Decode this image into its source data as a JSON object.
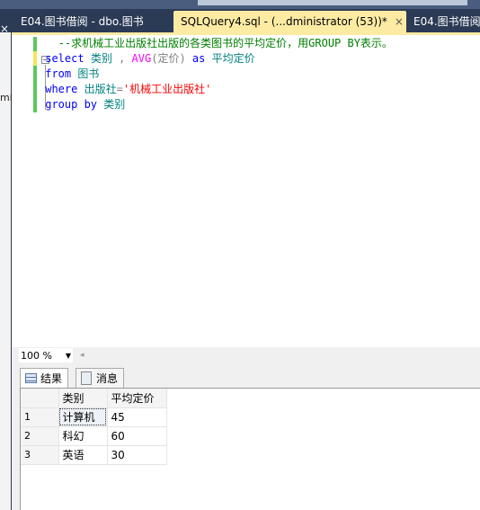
{
  "left_pane": {
    "close": "×",
    "partial": "mi"
  },
  "tabs": [
    {
      "label": "E04.图书借阅 - dbo.图书",
      "active": false
    },
    {
      "label": "SQLQuery4.sql - (...dministrator (53))*",
      "active": true,
      "close": "×"
    },
    {
      "label": "E04.图书借阅",
      "active": false
    }
  ],
  "editor": {
    "comment": "--求机械工业出版社出版的各类图书的平均定价，用GROUP BY表示。",
    "line2": {
      "kw1": "select",
      "c1": "类别",
      "sep": " ,",
      "fn": "AVG",
      "args": "(定价)",
      "kw2": "as",
      "alias": "平均定价"
    },
    "line3": {
      "kw": "from",
      "table": "图书"
    },
    "line4": {
      "kw": "where",
      "col": "出版社",
      "op": "=",
      "str": "'机械工业出版社'"
    },
    "line5": {
      "kw": "group by",
      "col": "类别"
    },
    "fold": "−"
  },
  "zoom": {
    "value": "100 %"
  },
  "results": {
    "tabs": [
      {
        "label": "结果",
        "icon": "grid-icon"
      },
      {
        "label": "消息",
        "icon": "message-icon"
      }
    ],
    "columns": [
      "类别",
      "平均定价"
    ],
    "rows": [
      [
        "1",
        "计算机",
        "45"
      ],
      [
        "2",
        "科幻",
        "60"
      ],
      [
        "3",
        "英语",
        "30"
      ]
    ]
  }
}
